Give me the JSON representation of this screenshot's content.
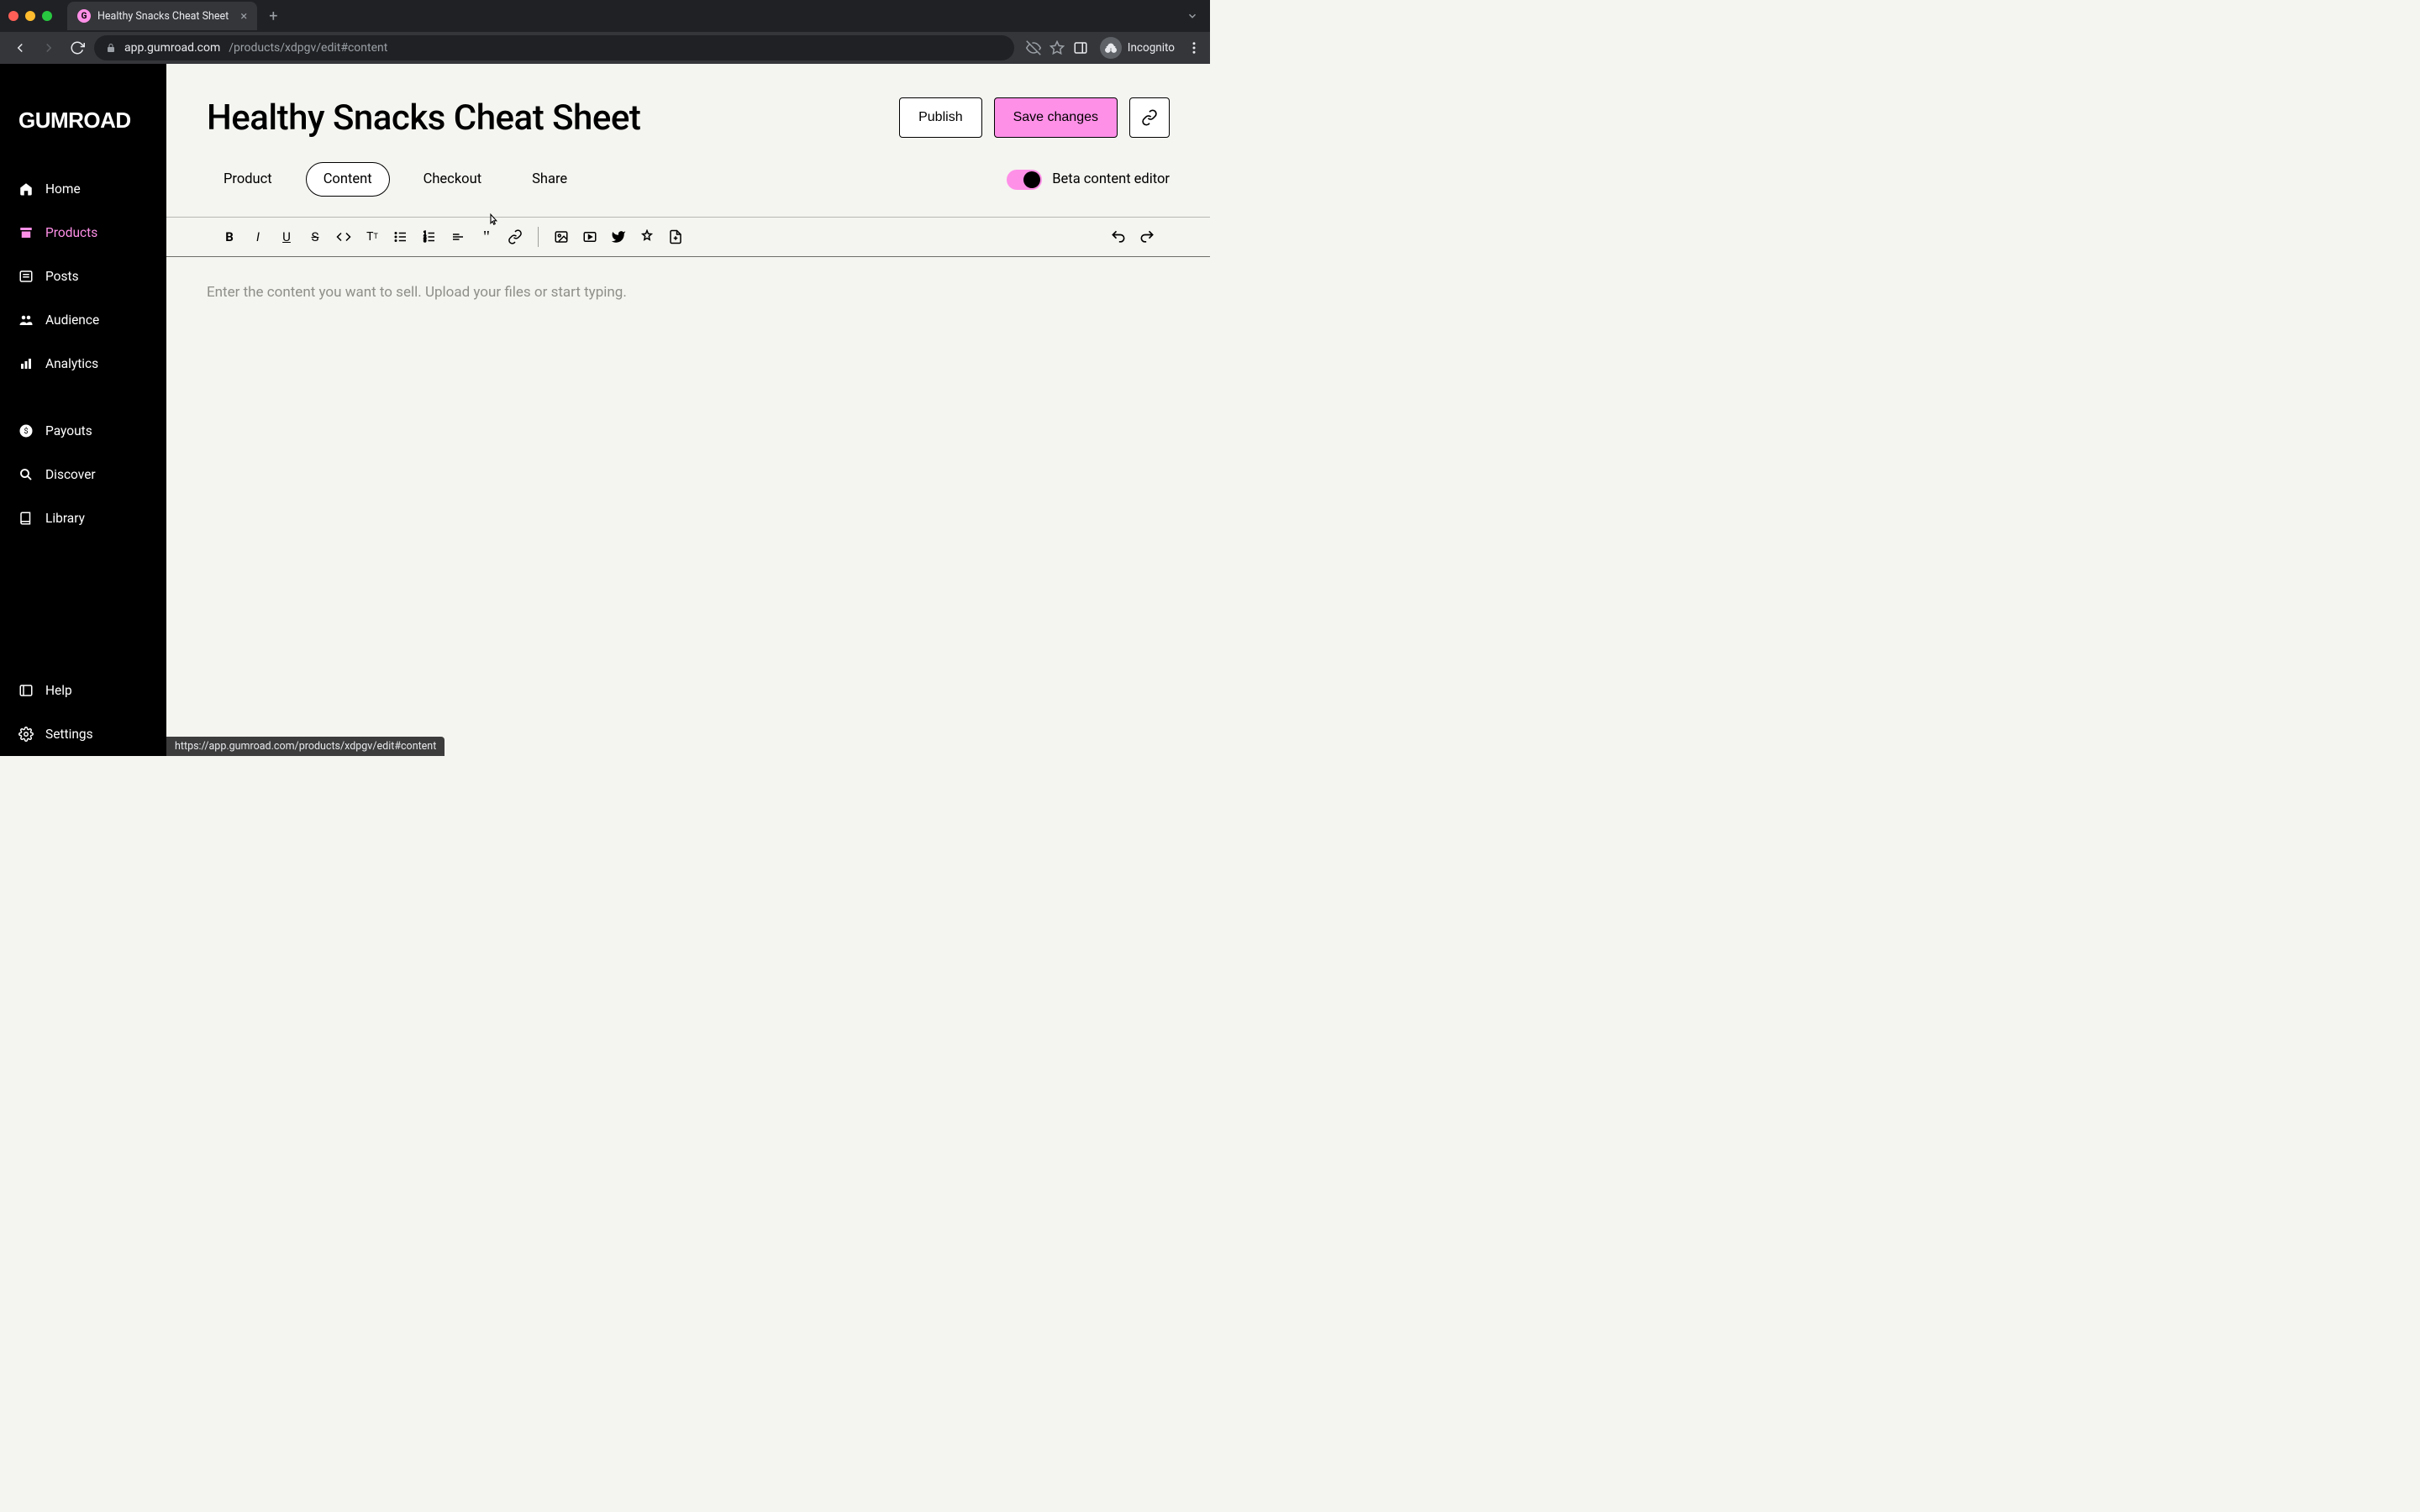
{
  "browser": {
    "tab_title": "Healthy Snacks Cheat Sheet",
    "url_host": "app.gumroad.com",
    "url_path": "/products/xdpgv/edit#content",
    "incognito_label": "Incognito",
    "status_bar": "https://app.gumroad.com/products/xdpgv/edit#content"
  },
  "sidebar": {
    "logo": "GUMROAD",
    "items": [
      {
        "label": "Home",
        "icon": "home-icon",
        "active": false
      },
      {
        "label": "Products",
        "icon": "archive-icon",
        "active": true
      },
      {
        "label": "Posts",
        "icon": "posts-icon",
        "active": false
      },
      {
        "label": "Audience",
        "icon": "audience-icon",
        "active": false
      },
      {
        "label": "Analytics",
        "icon": "analytics-icon",
        "active": false
      },
      {
        "label": "Payouts",
        "icon": "payouts-icon",
        "active": false
      },
      {
        "label": "Discover",
        "icon": "search-icon",
        "active": false
      },
      {
        "label": "Library",
        "icon": "library-icon",
        "active": false
      },
      {
        "label": "Help",
        "icon": "help-icon",
        "active": false
      },
      {
        "label": "Settings",
        "icon": "settings-icon",
        "active": false
      }
    ]
  },
  "page": {
    "title": "Healthy Snacks Cheat Sheet",
    "publish_label": "Publish",
    "save_label": "Save changes",
    "tabs": [
      {
        "label": "Product",
        "active": false
      },
      {
        "label": "Content",
        "active": true
      },
      {
        "label": "Checkout",
        "active": false
      },
      {
        "label": "Share",
        "active": false
      }
    ],
    "beta_toggle_label": "Beta content editor",
    "beta_toggle_on": true
  },
  "editor": {
    "placeholder": "Enter the content you want to sell. Upload your files or start typing.",
    "toolbar": [
      "bold",
      "italic",
      "underline",
      "strikethrough",
      "code",
      "heading",
      "bullet-list",
      "numbered-list",
      "divider",
      "quote",
      "link",
      "|",
      "image",
      "video",
      "twitter",
      "sparkle",
      "page",
      ">",
      "undo",
      "redo"
    ]
  },
  "colors": {
    "accent": "#ff90e8",
    "bg": "#f4f4f0",
    "sidebar": "#000000"
  }
}
